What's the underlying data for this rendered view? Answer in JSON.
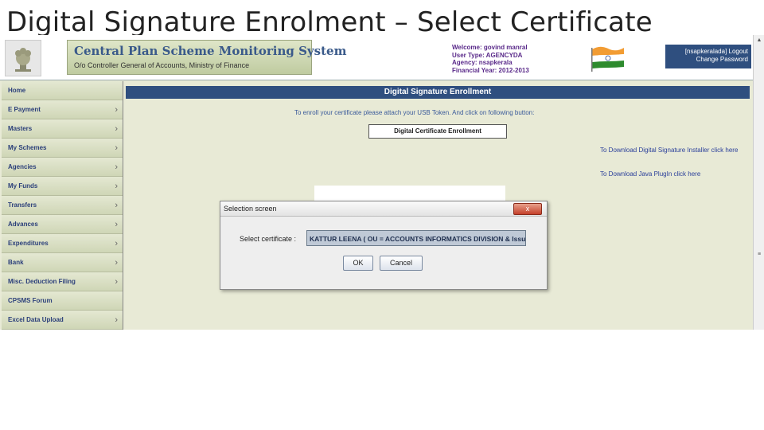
{
  "slide": {
    "title": "Digital Signature Enrolment – Select Certificate"
  },
  "header": {
    "app_title": "Central Plan Scheme Monitoring System",
    "app_subtitle": "O/o Controller General of Accounts, Ministry of Finance",
    "user_info": [
      "Welcome: govind manral",
      "User Type: AGENCYDA",
      "Agency: nsapkerala",
      "Financial Year: 2012-2013"
    ],
    "account_label": "[nsapkeralada]",
    "logout_label": "Logout",
    "change_password_label": "Change Password"
  },
  "sidebar": {
    "items": [
      {
        "label": "Home",
        "has_chevron": false
      },
      {
        "label": "E Payment",
        "has_chevron": true
      },
      {
        "label": "Masters",
        "has_chevron": true
      },
      {
        "label": "My Schemes",
        "has_chevron": true
      },
      {
        "label": "Agencies",
        "has_chevron": true
      },
      {
        "label": "My Funds",
        "has_chevron": true
      },
      {
        "label": "Transfers",
        "has_chevron": true
      },
      {
        "label": "Advances",
        "has_chevron": true
      },
      {
        "label": "Expenditures",
        "has_chevron": true
      },
      {
        "label": "Bank",
        "has_chevron": true
      },
      {
        "label": "Misc. Deduction Filing",
        "has_chevron": true
      },
      {
        "label": "CPSMS Forum",
        "has_chevron": false
      },
      {
        "label": "Excel Data Upload",
        "has_chevron": true
      }
    ]
  },
  "main": {
    "header": "Digital Signature Enrollment",
    "instruction": "To enroll your certificate please attach your USB Token. And click on following button:",
    "enroll_button": "Digital Certificate Enrollment",
    "link_signer": "To Download Digital Signature Installer click here",
    "link_java": "To Download Java PlugIn click here"
  },
  "dialog": {
    "title": "Selection screen",
    "close_label": "x",
    "cert_label": "Select certificate :",
    "cert_value": "KATTUR LEENA ( OU = ACCOUNTS INFORMATICS DIVISION & Issu",
    "ok_label": "OK",
    "cancel_label": "Cancel"
  },
  "colors": {
    "nav_text": "#2b3f7a",
    "header_bar": "#2f4f7f",
    "page_bg": "#e8ead6",
    "close_button": "#c4402a"
  },
  "icons": {
    "emblem": "national-emblem-icon",
    "flag": "indian-flag-icon",
    "chevron": "chevron-right-icon"
  }
}
